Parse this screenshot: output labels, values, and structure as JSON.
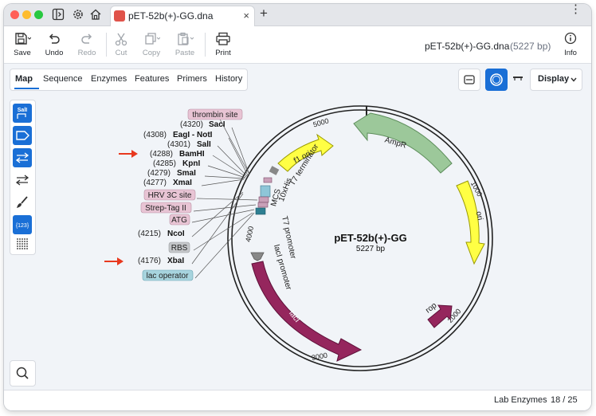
{
  "window": {
    "tab_title": "pET-52b(+)-GG.dna",
    "tab_close": "×",
    "new_tab": "+",
    "menu": "⋮"
  },
  "toolbar": {
    "save": "Save",
    "undo": "Undo",
    "redo": "Redo",
    "cut": "Cut",
    "copy": "Copy",
    "paste": "Paste",
    "print": "Print",
    "info": "Info",
    "doc_name": "pET-52b(+)-GG.dna",
    "doc_length": "(5227 bp)"
  },
  "subtabs": [
    "Map",
    "Sequence",
    "Enzymes",
    "Features",
    "Primers",
    "History"
  ],
  "view": {
    "display_label": "Display"
  },
  "palette": {
    "sali": "SalI",
    "num": "{123}"
  },
  "map": {
    "name": "pET-52b(+)-GG",
    "length": "5227 bp",
    "ticks": {
      "t5000": "5000",
      "t1000": "1000",
      "t2000": "2000",
      "t3000": "3000",
      "t4000": "4000"
    },
    "features": {
      "ampr": "AmpR",
      "f1ori": "f1 ori",
      "ori": "ori",
      "rop": "rop",
      "laci": "lacI",
      "t7term": "T7 terminator",
      "his": "10xHis",
      "mcs": "MCS",
      "t7prom": "T7 promoter",
      "laciprom": "lacI promoter"
    },
    "labels": {
      "thrombin": "thrombin site",
      "sacI_pos": "(4320)",
      "sacI": "SacI",
      "eagI_pos": "(4308)",
      "eagI": "EagI - NotI",
      "salI_pos": "(4301)",
      "salI": "SalI",
      "bamHI_pos": "(4288)",
      "bamHI": "BamHI",
      "kpnI_pos": "(4285)",
      "kpnI": "KpnI",
      "smaI_pos": "(4279)",
      "smaI": "SmaI",
      "xmaI_pos": "(4277)",
      "xmaI": "XmaI",
      "hrv": "HRV 3C site",
      "strep": "Strep-Tag II",
      "atg": "ATG",
      "ncoI_pos": "(4215)",
      "ncoI": "NcoI",
      "rbs": "RBS",
      "xbaI_pos": "(4176)",
      "xbaI": "XbaI",
      "lacop": "lac operator"
    }
  },
  "status": {
    "enzymes": "Lab Enzymes",
    "count": "18 / 25"
  },
  "colors": {
    "accent": "#1a6fd6",
    "ampr": "#8fbf8f",
    "ori": "#ffff33",
    "laci": "#95265d",
    "arrow": "#e8381e"
  }
}
